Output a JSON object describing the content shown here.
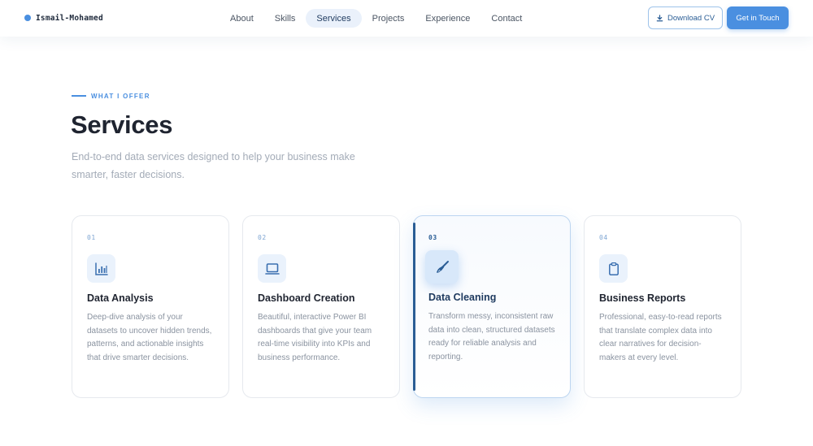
{
  "nav": {
    "brand": "Ismail-Mohamed",
    "links": [
      "About",
      "Skills",
      "Services",
      "Projects",
      "Experience",
      "Contact"
    ],
    "active": "Services",
    "download_cv": "Download CV",
    "get_in_touch": "Get in Touch"
  },
  "section": {
    "eyebrow": "WHAT I OFFER",
    "title": "Services",
    "subtitle": "End-to-end data services designed to help your business make smarter, faster decisions."
  },
  "cards": [
    {
      "num": "01",
      "icon": "bar-chart-icon",
      "title": "Data Analysis",
      "desc": "Deep-dive analysis of your datasets to uncover hidden trends, patterns, and actionable insights that drive smarter decisions."
    },
    {
      "num": "02",
      "icon": "monitor-icon",
      "title": "Dashboard Creation",
      "desc": "Beautiful, interactive Power BI dashboards that give your team real-time visibility into KPIs and business performance."
    },
    {
      "num": "03",
      "icon": "broom-icon",
      "title": "Data Cleaning",
      "desc": "Transform messy, inconsistent raw data into clean, structured datasets ready for reliable analysis and reporting."
    },
    {
      "num": "04",
      "icon": "clipboard-icon",
      "title": "Business Reports",
      "desc": "Professional, easy-to-read reports that translate complex data into clear narratives for decision-makers at every level."
    }
  ],
  "colors": {
    "accent": "#4a8fe0",
    "accent_dark": "#2a5d95",
    "text_dark": "#1f2430",
    "text_muted": "#8a93a0"
  }
}
